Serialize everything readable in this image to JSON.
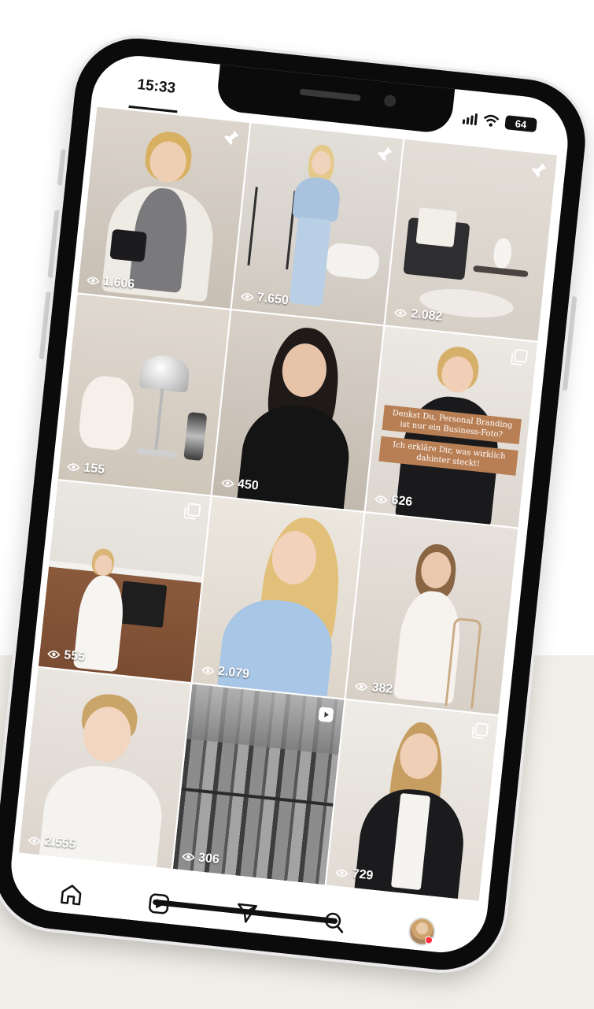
{
  "status_bar": {
    "time": "15:33",
    "battery": "64"
  },
  "grid": [
    {
      "views": "1.606",
      "badge": "pin"
    },
    {
      "views": "7.650",
      "badge": "pin"
    },
    {
      "views": "2.082",
      "badge": "pin"
    },
    {
      "views": "155",
      "badge": ""
    },
    {
      "views": "450",
      "badge": ""
    },
    {
      "views": "626",
      "badge": "carousel",
      "overlay": [
        "Denkst Du, Personal Branding ist nur ein Business-Foto?",
        "Ich erkläre Dir, was wirklich dahinter steckt!"
      ]
    },
    {
      "views": "555",
      "badge": "carousel"
    },
    {
      "views": "2.079",
      "badge": ""
    },
    {
      "views": "382",
      "badge": ""
    },
    {
      "views": "2.555",
      "badge": ""
    },
    {
      "views": "306",
      "badge": "reel"
    },
    {
      "views": "729",
      "badge": "carousel"
    }
  ],
  "bottom_nav": [
    "home-icon",
    "reels-icon",
    "send-icon",
    "search-icon",
    "profile-avatar"
  ],
  "colors": {
    "accent": "#ff3040",
    "overlay_label": "#b87f55",
    "band": "#f1ede7"
  }
}
